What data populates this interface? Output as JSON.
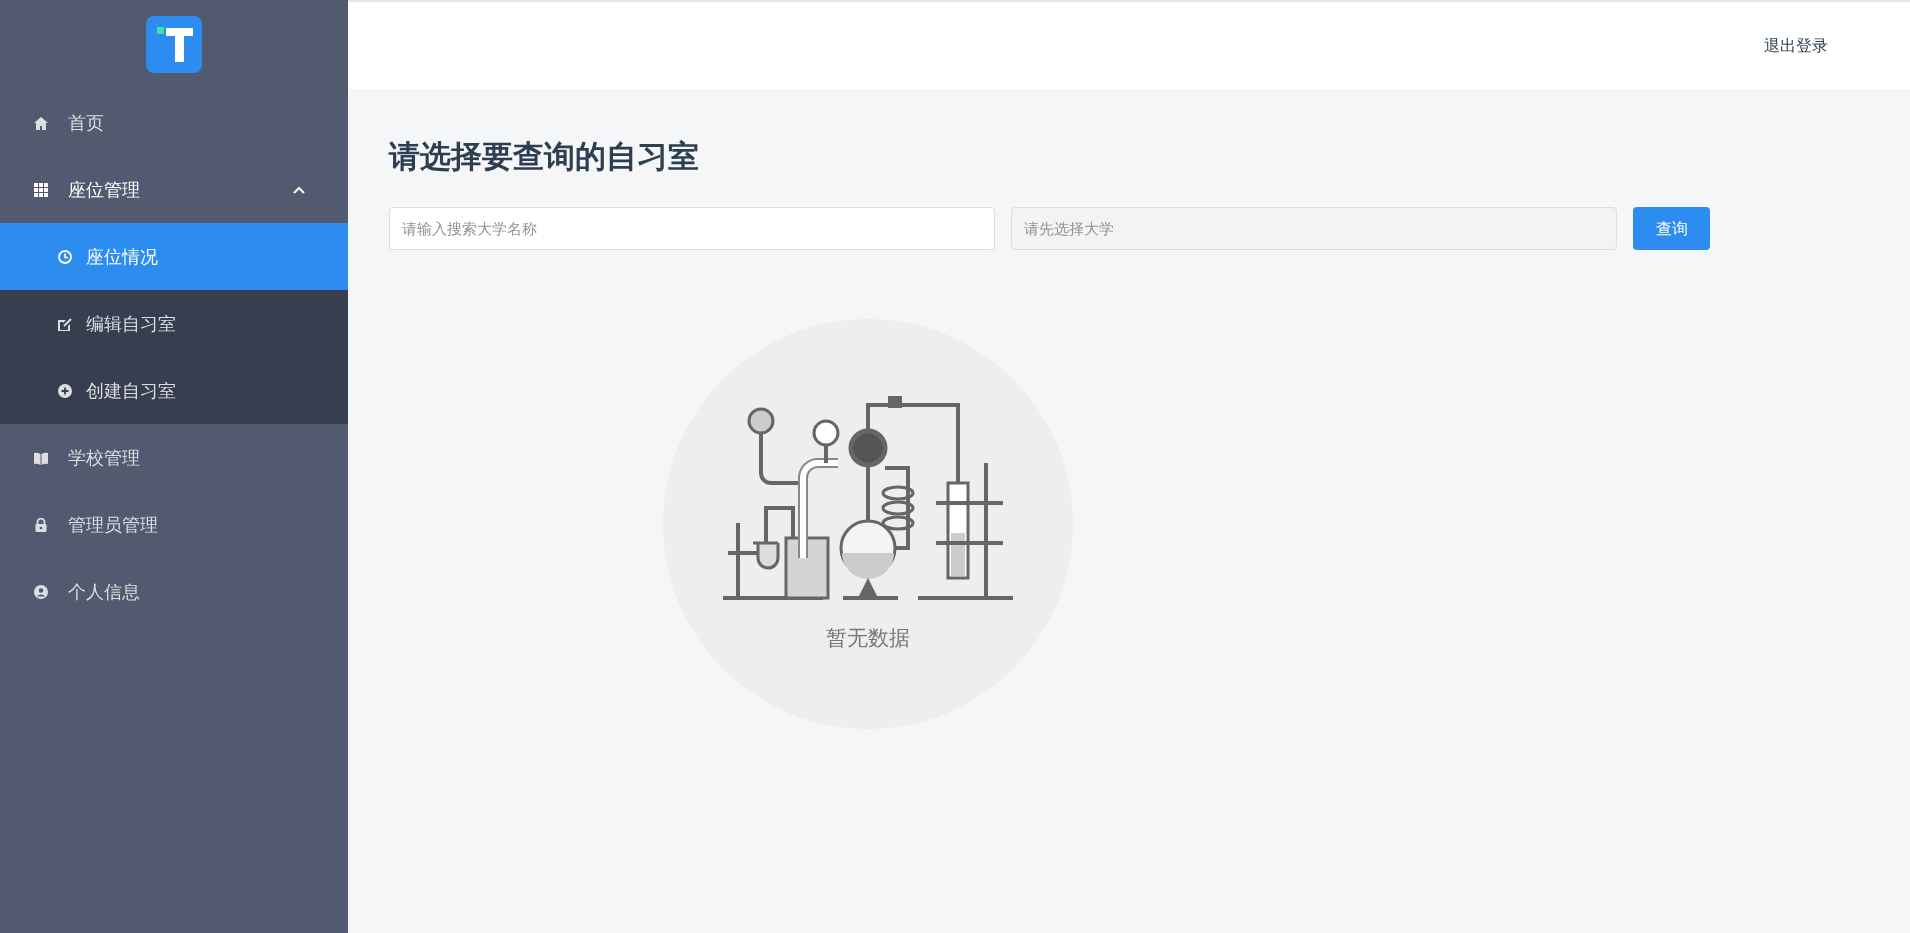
{
  "sidebar": {
    "items": [
      {
        "label": "首页",
        "selected": false
      },
      {
        "label": "座位管理",
        "selected": false,
        "expanded": true,
        "children": [
          {
            "label": "座位情况",
            "selected": true
          },
          {
            "label": "编辑自习室",
            "selected": false
          },
          {
            "label": "创建自习室",
            "selected": false
          }
        ]
      },
      {
        "label": "学校管理",
        "selected": false
      },
      {
        "label": "管理员管理",
        "selected": false
      },
      {
        "label": "个人信息",
        "selected": false
      }
    ]
  },
  "header": {
    "logout": "退出登录"
  },
  "page": {
    "title": "请选择要查询的自习室",
    "search": {
      "placeholder": "请输入搜索大学名称"
    },
    "select": {
      "placeholder": "请先选择大学",
      "disabled": true
    },
    "button": "查询",
    "empty": {
      "text": "暂无数据"
    }
  }
}
